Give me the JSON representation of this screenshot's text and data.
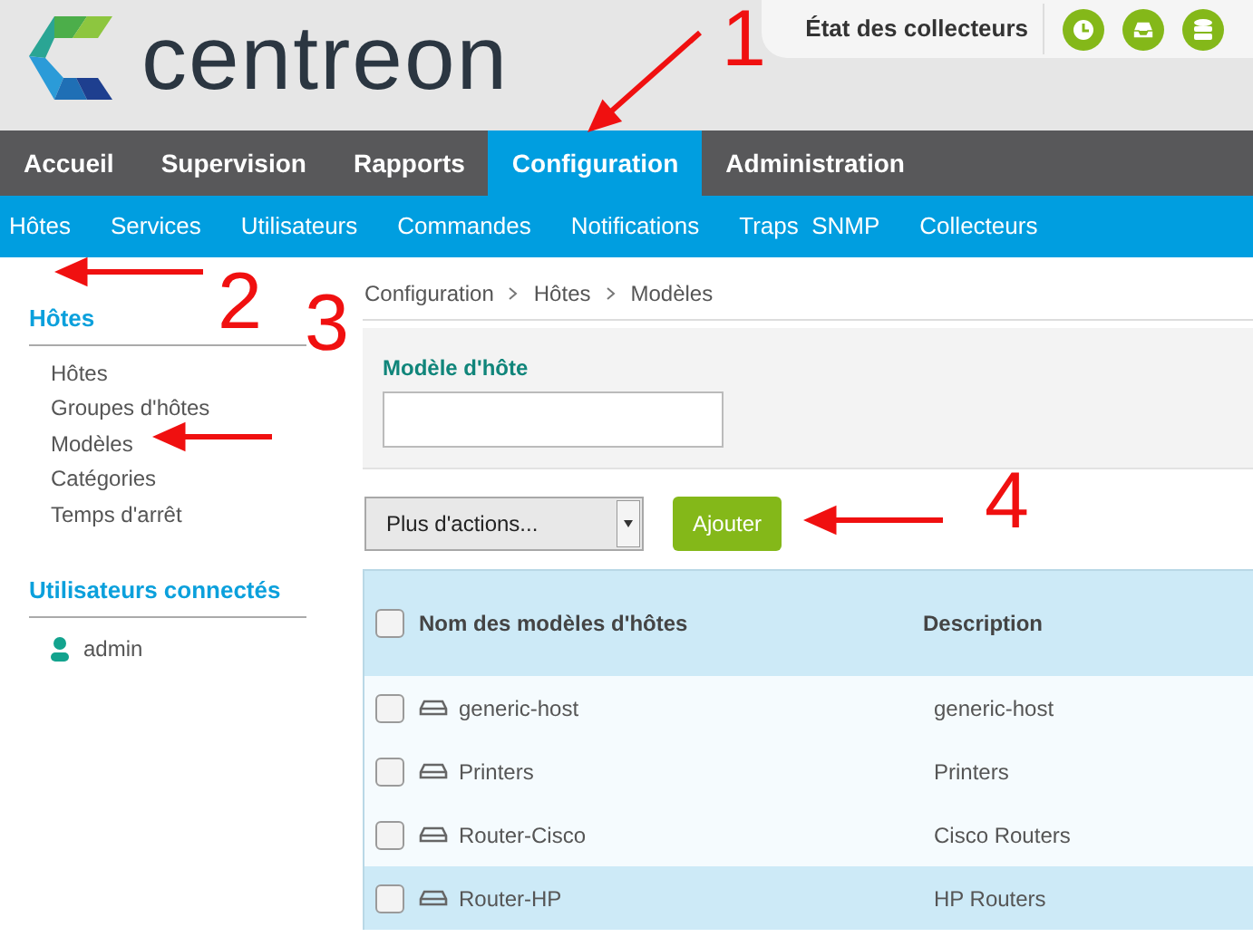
{
  "header": {
    "logo_text": "centreon",
    "collectors_label": "État des collecteurs"
  },
  "main_nav": [
    {
      "label": "Accueil",
      "selected": false
    },
    {
      "label": "Supervision",
      "selected": false
    },
    {
      "label": "Rapports",
      "selected": false
    },
    {
      "label": "Configuration",
      "selected": true
    },
    {
      "label": "Administration",
      "selected": false
    }
  ],
  "sub_nav": [
    "Hôtes",
    "Services",
    "Utilisateurs",
    "Commandes",
    "Notifications",
    "Traps  SNMP",
    "Collecteurs"
  ],
  "sidebar": {
    "sections": [
      {
        "title": "Hôtes",
        "items": [
          "Hôtes",
          "Groupes d'hôtes",
          "Modèles",
          "Catégories",
          "Temps d'arrêt"
        ]
      },
      {
        "title": "Utilisateurs connectés",
        "users": [
          "admin"
        ]
      }
    ]
  },
  "breadcrumb": [
    "Configuration",
    "Hôtes",
    "Modèles"
  ],
  "filter": {
    "label": "Modèle d'hôte"
  },
  "actions": {
    "select": "Plus d'actions...",
    "add_button": "Ajouter"
  },
  "table": {
    "columns": [
      "Nom des modèles d'hôtes",
      "Description"
    ],
    "header_checked": false,
    "rows": [
      {
        "name": "generic-host",
        "description": "generic-host",
        "checked": false,
        "highlighted": false
      },
      {
        "name": "Printers",
        "description": "Printers",
        "checked": false,
        "highlighted": false
      },
      {
        "name": "Router-Cisco",
        "description": "Cisco Routers",
        "checked": false,
        "highlighted": false
      },
      {
        "name": "Router-HP",
        "description": "HP Routers",
        "checked": false,
        "highlighted": true
      }
    ]
  },
  "annotations": [
    "1",
    "2",
    "3",
    "4"
  ]
}
